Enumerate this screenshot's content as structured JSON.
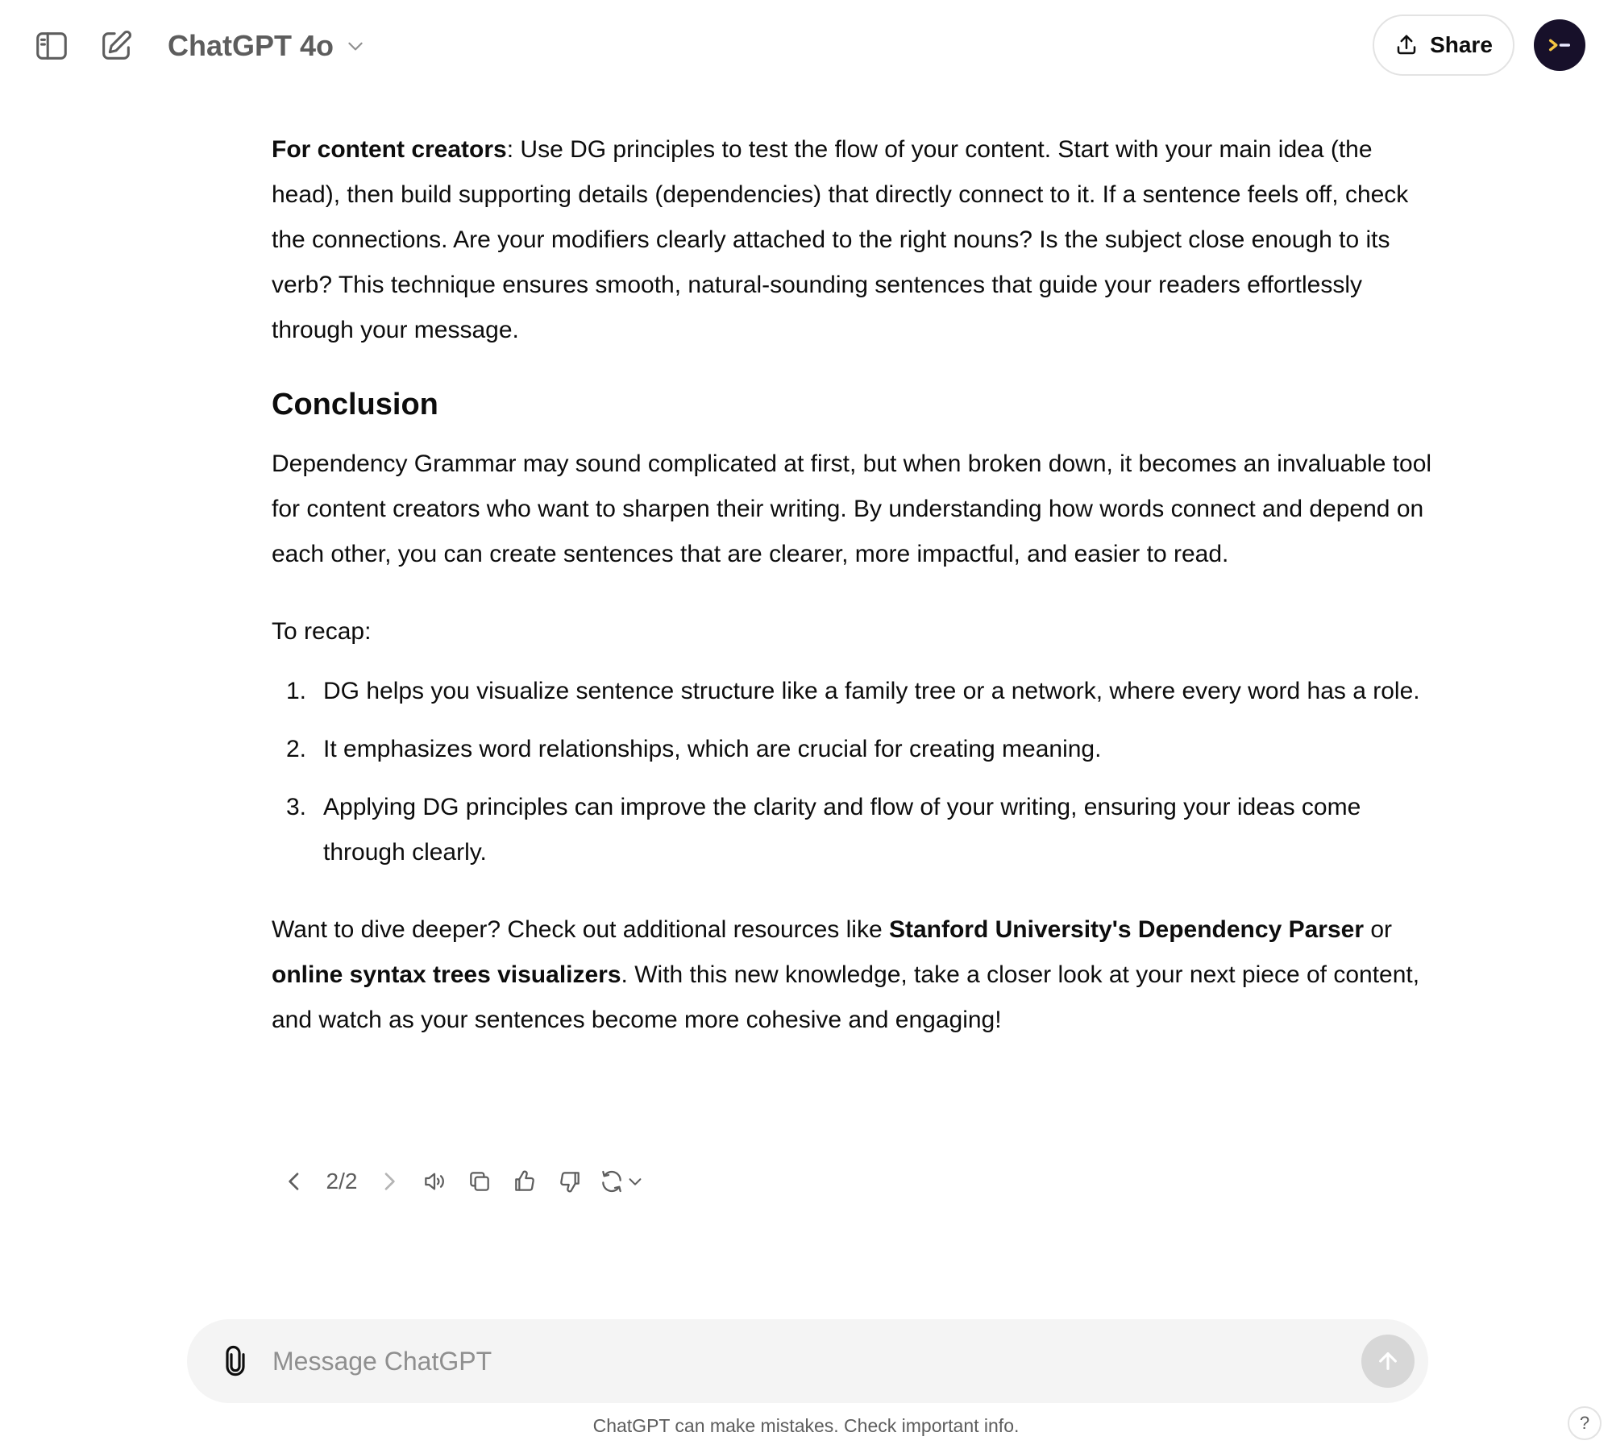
{
  "header": {
    "model_name": "ChatGPT 4o",
    "share_label": "Share"
  },
  "message": {
    "para1": {
      "bold_lead": "For content creators",
      "text": ": Use DG principles to test the flow of your content. Start with your main idea (the head), then build supporting details (dependencies) that directly connect to it. If a sentence feels off, check the connections. Are your modifiers clearly attached to the right nouns? Is the subject close enough to its verb? This technique ensures smooth, natural-sounding sentences that guide your readers effortlessly through your message."
    },
    "heading": "Conclusion",
    "para2": "Dependency Grammar may sound complicated at first, but when broken down, it becomes an invaluable tool for content creators who want to sharpen their writing. By understanding how words connect and depend on each other, you can create sentences that are clearer, more impactful, and easier to read.",
    "recap_intro": "To recap:",
    "recap_items": [
      {
        "num": "1.",
        "text": "DG helps you visualize sentence structure like a family tree or a network, where every word has a role."
      },
      {
        "num": "2.",
        "text": "It emphasizes word relationships, which are crucial for creating meaning."
      },
      {
        "num": "3.",
        "text": "Applying DG principles can improve the clarity and flow of your writing, ensuring your ideas come through clearly."
      }
    ],
    "para3": {
      "t1": "Want to dive deeper? Check out additional resources like ",
      "b1": "Stanford University's Dependency Parser",
      "t2": " or ",
      "b2": "online syntax trees visualizers",
      "t3": ". With this new knowledge, take a closer look at your next piece of content, and watch as your sentences become more cohesive and engaging!"
    }
  },
  "actions": {
    "page_indicator": "2/2"
  },
  "composer": {
    "placeholder": "Message ChatGPT"
  },
  "footer": {
    "disclaimer": "ChatGPT can make mistakes. Check important info.",
    "help_label": "?"
  },
  "colors": {
    "text": "#0d0d0d",
    "muted": "#5d5d5d",
    "composer_bg": "#f4f4f4",
    "send_disabled": "#d7d7d7",
    "avatar_bg": "#17102a",
    "avatar_accent": "#f5c542"
  },
  "icons": {
    "sidebar": "sidebar-toggle-icon",
    "new_chat": "edit-icon",
    "model_caret": "chevron-down-icon",
    "share": "upload-icon",
    "avatar": "terminal-prompt-icon",
    "prev": "chevron-left-icon",
    "next": "chevron-right-icon",
    "read_aloud": "speaker-icon",
    "copy": "copy-icon",
    "good": "thumbs-up-icon",
    "bad": "thumbs-down-icon",
    "regenerate": "refresh-icon",
    "attach": "paperclip-icon",
    "send": "arrow-up-icon"
  }
}
